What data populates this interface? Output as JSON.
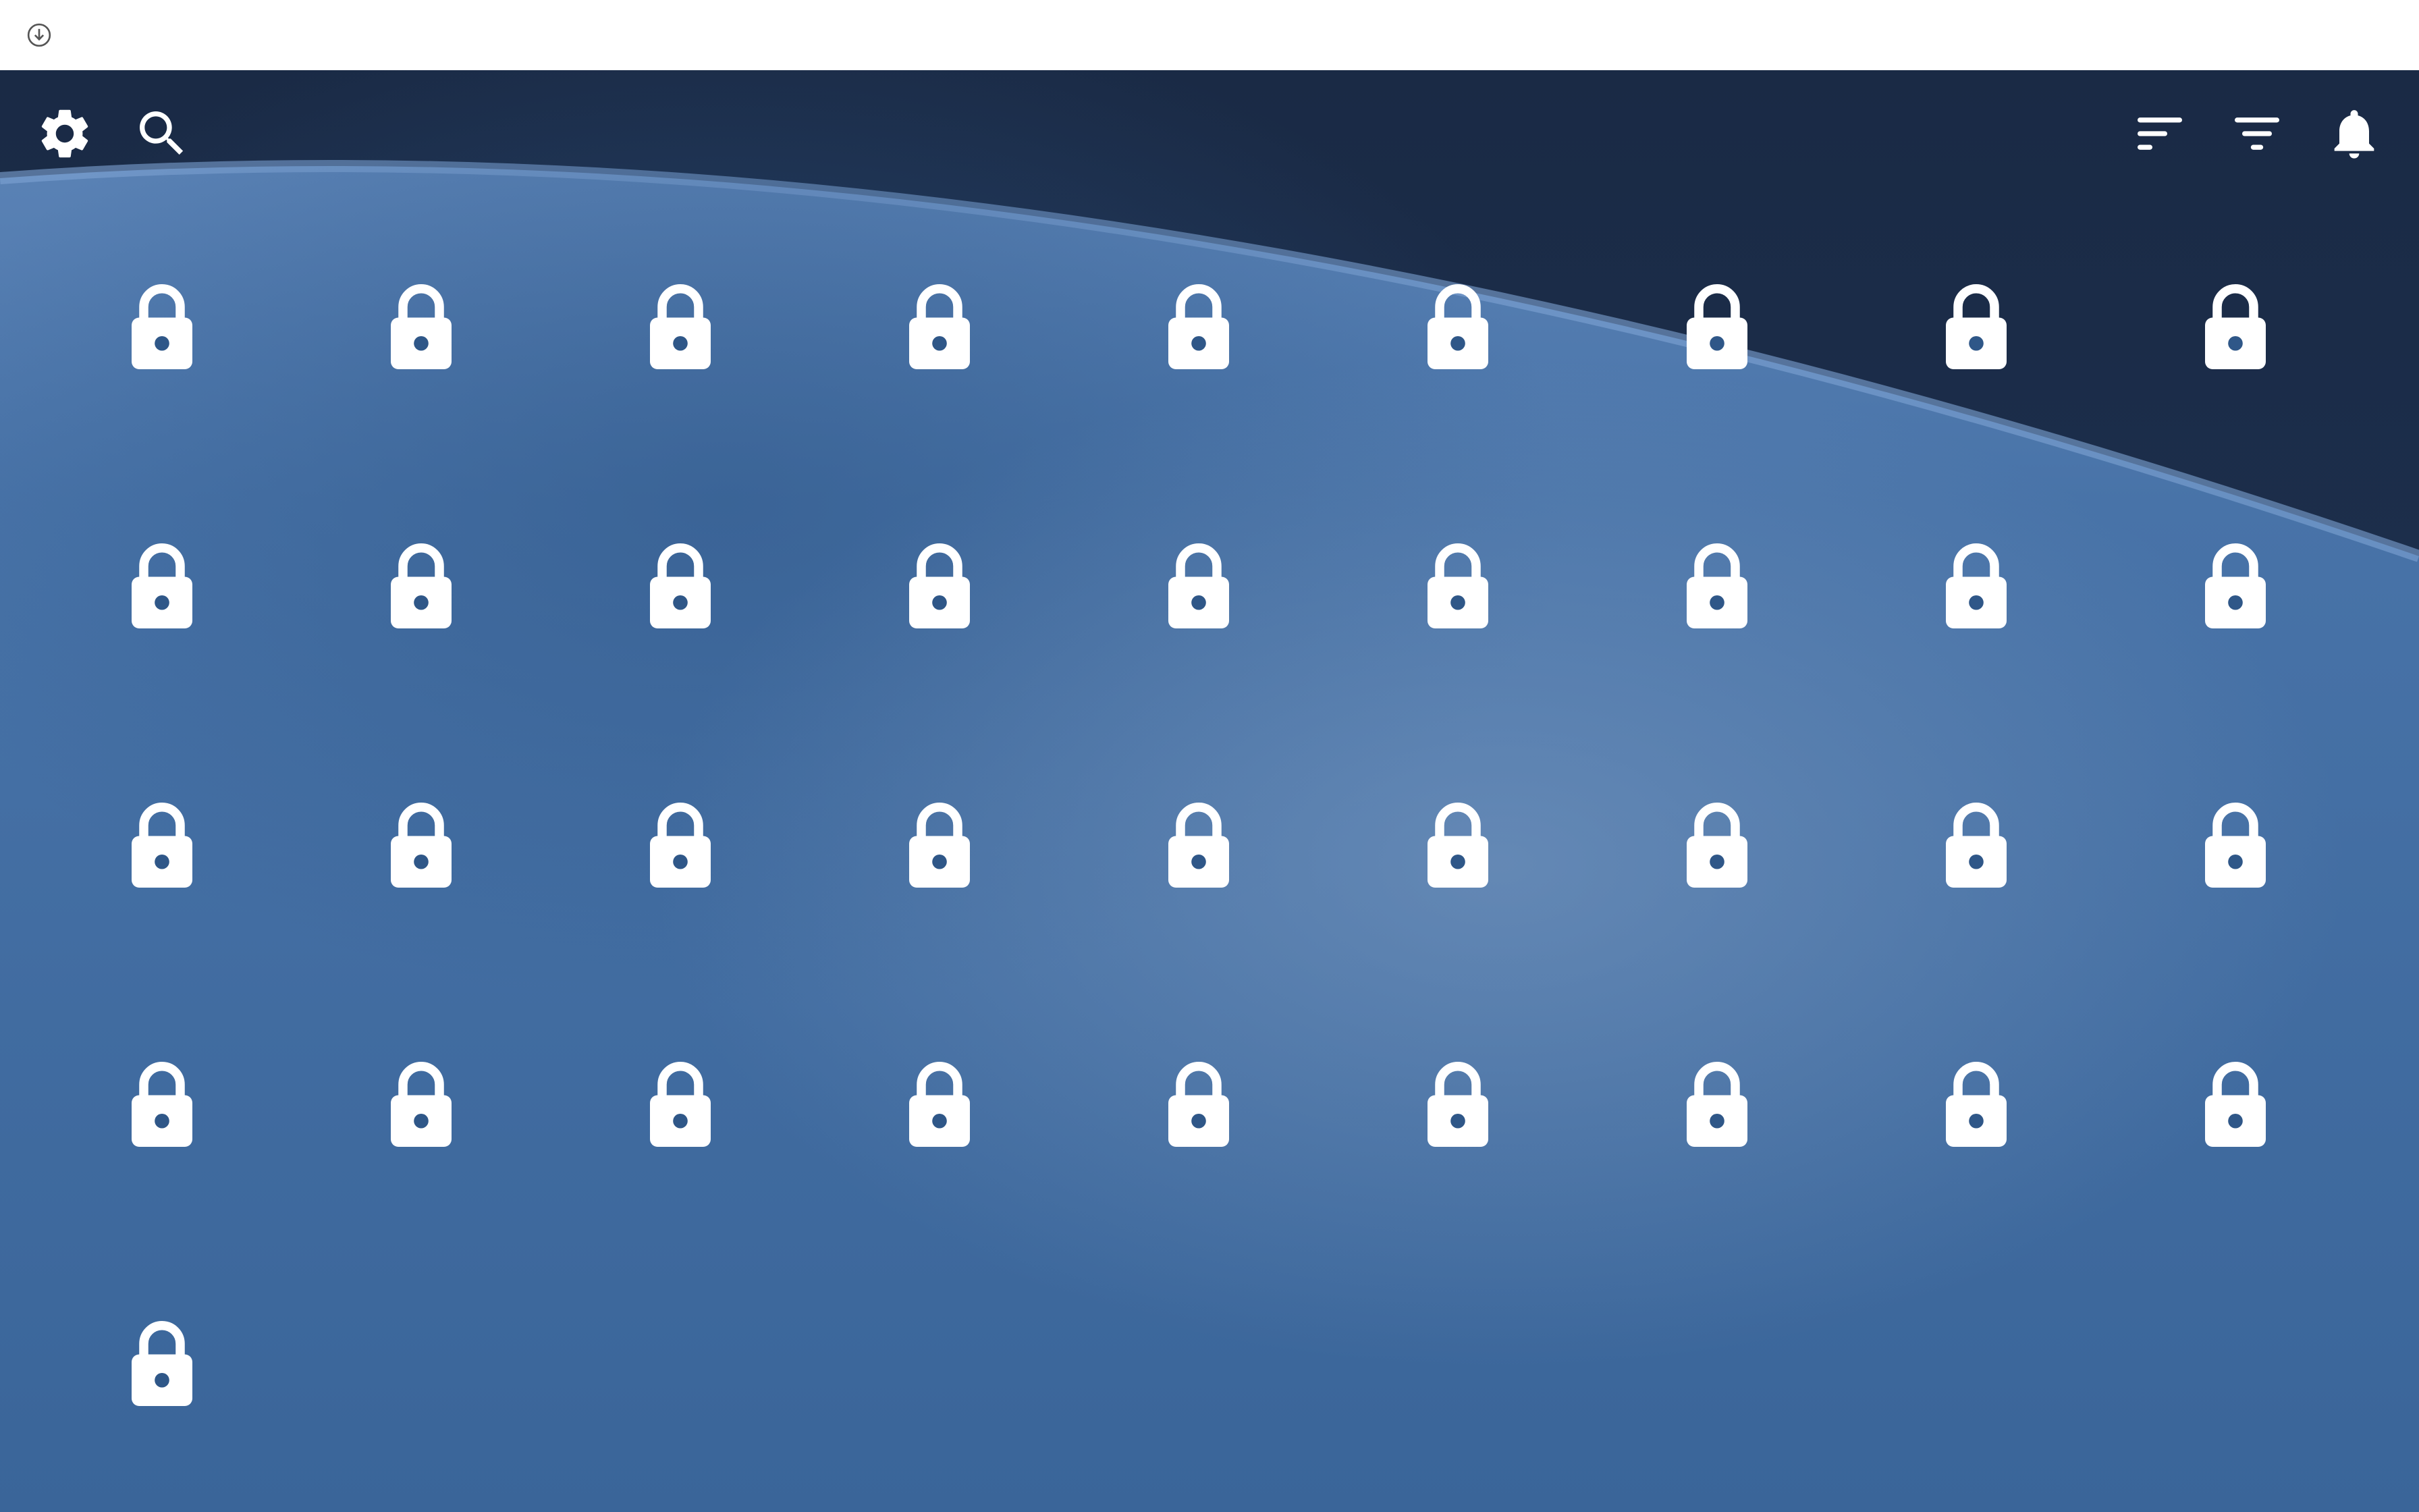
{
  "topbar": {
    "download_icon": "download-circle-icon"
  },
  "toolbar": {
    "left": [
      {
        "icon": "gear-icon"
      },
      {
        "icon": "search-icon"
      }
    ],
    "right": [
      {
        "icon": "sort-icon"
      },
      {
        "icon": "filter-icon"
      },
      {
        "icon": "bell-icon"
      }
    ]
  },
  "grid": {
    "columns": 9,
    "tile_icon": "lock-icon",
    "tile_count": 37
  },
  "colors": {
    "icon": "#ffffff",
    "background_top": "#1a2a45",
    "background_bottom": "#3a6599"
  }
}
